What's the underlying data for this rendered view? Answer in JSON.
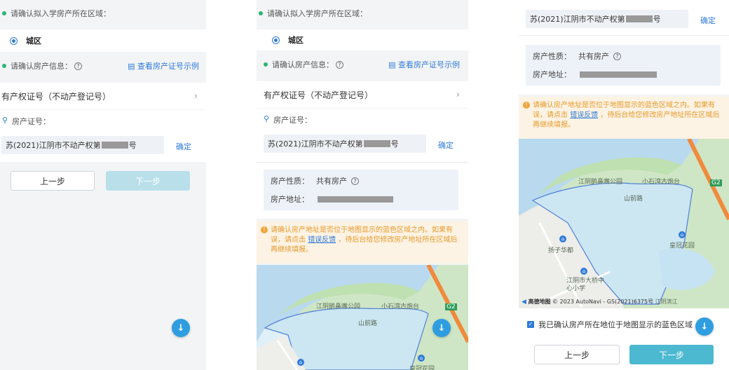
{
  "form": {
    "region_prompt": "请确认拟入学房产所在区域：",
    "region_option": "城区",
    "property_info_prompt": "请确认房产信息：",
    "view_sample_link": "查看房产证号示例",
    "cert_type": "有产权证号（不动产登记号）",
    "cert_number_label": "房产证号：",
    "cert_number_prefix": "苏(2021)江阴市不动产权第",
    "cert_number_suffix": "号",
    "confirm_label": "确定",
    "prev_button": "上一步",
    "next_button": "下一步"
  },
  "property": {
    "nature_label": "房产性质：",
    "nature_value": "共有房产",
    "address_label": "房产地址："
  },
  "notice": {
    "text_before_link": "请确认房产地址是否位于地图显示的蓝色区域之内。如果有误，请点击",
    "link": "错误反馈",
    "text_after_link": "，待后台给您修改房产地址所在区域后再继续填报。"
  },
  "map": {
    "park": "江阴鹅鼻嘴公园",
    "temple": "小石湾古炮台",
    "road": "山前路",
    "road2": "滨江路",
    "estate": "扬子华都",
    "school": "江阴市大桥中心小学",
    "garden": "皇冠花园",
    "highway_badge": "G2",
    "provider": "高德地图",
    "copyright": "© 2023 AutoNavi - GS(2021)6375号",
    "partial_label": "江阴滨江"
  },
  "confirmation": {
    "checkbox_label": "我已确认房产所在地位于地图显示的蓝色区域"
  },
  "colors": {
    "accent": "#2f7bd9",
    "success_dot": "#2bb673",
    "warning": "#e69a2a",
    "next_disabled": "#b9e0ea",
    "next_enabled": "#4cb9d1"
  }
}
